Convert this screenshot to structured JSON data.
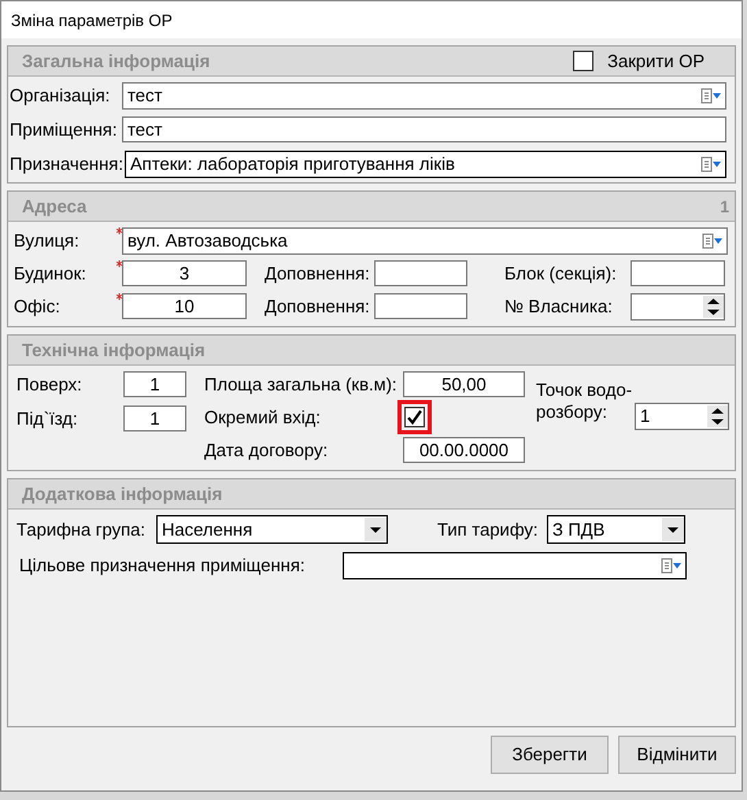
{
  "window": {
    "title": "Зміна параметрів ОР"
  },
  "general": {
    "title": "Загальна інформація",
    "close_checkbox": {
      "label": "Закрити ОР",
      "checked": false
    },
    "organization": {
      "label": "Організація:",
      "value": "тест"
    },
    "premises": {
      "label": "Приміщення:",
      "value": "тест"
    },
    "purpose": {
      "label": "Призначення:",
      "value": "Аптеки: лабораторія приготування ліків"
    }
  },
  "address": {
    "title": "Адреса",
    "counter": "1",
    "street": {
      "label": "Вулиця:",
      "value": "вул. Автозаводська",
      "required": true
    },
    "house": {
      "label": "Будинок:",
      "value": "3",
      "required": true
    },
    "house_addition": {
      "label": "Доповнення:"
    },
    "block": {
      "label": "Блок (секція):"
    },
    "office": {
      "label": "Офіс:",
      "value": "10",
      "required": true
    },
    "office_addition": {
      "label": "Доповнення:"
    },
    "owner_number": {
      "label": "№ Власника:"
    }
  },
  "technical": {
    "title": "Технічна інформація",
    "floor": {
      "label": "Поверх:",
      "value": "1"
    },
    "entrance": {
      "label": "Під`їзд:",
      "value": "1"
    },
    "total_area": {
      "label": "Площа загальна (кв.м):",
      "value": "50,00"
    },
    "separate_entrance": {
      "label": "Окремий вхід:",
      "checked": true,
      "highlighted": true
    },
    "contract_date": {
      "label": "Дата договору:",
      "value": "00.00.0000"
    },
    "water_points": {
      "label": "Точок водо-розбору:",
      "value": "1"
    }
  },
  "additional": {
    "title": "Додаткова інформація",
    "tariff_group": {
      "label": "Тарифна група:",
      "value": "Населення"
    },
    "tariff_type": {
      "label": "Тип тарифу:",
      "value": "З ПДВ"
    },
    "target_purpose": {
      "label": "Цільове призначення приміщення:"
    }
  },
  "buttons": [
    "Зберегти",
    "Відмінити"
  ]
}
